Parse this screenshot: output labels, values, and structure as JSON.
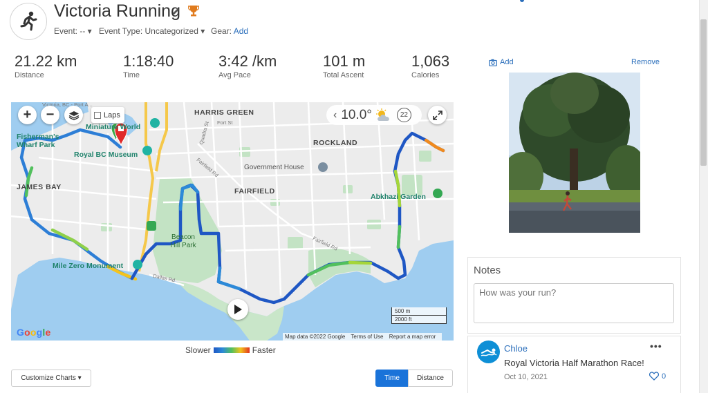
{
  "activity": {
    "icon": "runner-icon",
    "title": "Victoria Running",
    "event_label": "Event: -- ▾",
    "event_type_label": "Event Type: Uncategorized ▾",
    "gear_label": "Gear:",
    "gear_link": "Add"
  },
  "stats": [
    {
      "value": "21.22 km",
      "label": "Distance"
    },
    {
      "value": "1:18:40",
      "label": "Time"
    },
    {
      "value": "3:42 /km",
      "label": "Avg Pace"
    },
    {
      "value": "101 m",
      "label": "Total Ascent"
    },
    {
      "value": "1,063",
      "label": "Calories"
    }
  ],
  "map": {
    "laps_label": "Laps",
    "temperature": "10.0°",
    "wind": "22",
    "places": {
      "harris_green": "HARRIS GREEN",
      "rockland": "ROCKLAND",
      "james_bay": "JAMES BAY",
      "fairfield": "FAIRFIELD",
      "government_house": "Government House",
      "royal_bc_museum": "Royal BC Museum",
      "abkhazi_garden": "Abkhazi Garden",
      "mile_zero": "Mile Zero Monument",
      "beacon_hill": "Beacon Hill Park",
      "fishermans_wharf": "Fisherman's Wharf Park",
      "miniature_world": "Miniature World",
      "victoria_bc": "Victoria, BC - Port A..."
    },
    "streets": {
      "fort_st": "Fort St",
      "quadra_st": "Quadra St",
      "fairfield_rd": "Fairfield Rd",
      "dallas_rd": "Dallas Rd",
      "fairfield_rd_2": "Fairfield Rd"
    },
    "scale_m": "500 m",
    "scale_ft": "2000 ft",
    "google": "Google",
    "map_data": "Map data ©2022 Google",
    "terms": "Terms of Use",
    "report": "Report a map error"
  },
  "legend": {
    "slower": "Slower",
    "faster": "Faster"
  },
  "controls": {
    "customize": "Customize Charts ▾",
    "time": "Time",
    "distance": "Distance"
  },
  "photo": {
    "add": "Add",
    "remove": "Remove"
  },
  "notes": {
    "title": "Notes",
    "placeholder": "How was your run?"
  },
  "comment": {
    "author": "Chloe",
    "text": "Royal Victoria Half Marathon Race!",
    "date": "Oct 10, 2021",
    "likes": "0",
    "more": "•••"
  },
  "colors": {
    "accent": "#1a73d9",
    "link": "#2a6ebb",
    "slower": "#1f57c4",
    "faster": "#e2341f"
  }
}
